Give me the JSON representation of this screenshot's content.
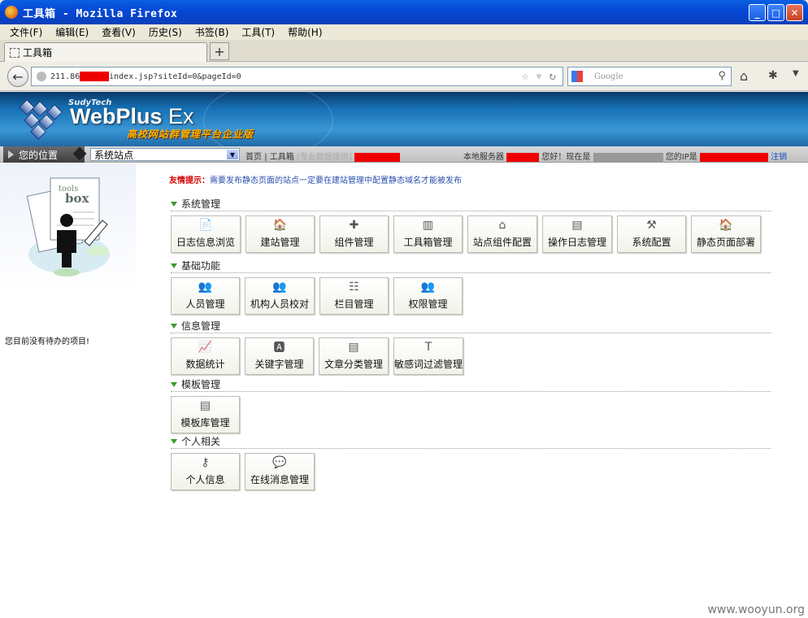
{
  "window": {
    "title": "工具箱 - Mozilla Firefox"
  },
  "menu": [
    "文件(F)",
    "编辑(E)",
    "查看(V)",
    "历史(S)",
    "书签(B)",
    "工具(T)",
    "帮助(H)"
  ],
  "tab": {
    "title": "工具箱",
    "new_tab": "+"
  },
  "address": {
    "prefix": "211.86",
    "suffix": "index.jsp?siteId=0&pageId=0"
  },
  "search": {
    "placeholder": "Google"
  },
  "banner": {
    "sub": "SudyTech",
    "brand": "WebPlus",
    "brand_ex": " Ex",
    "cn": "高校网站群管理平台企业版"
  },
  "location": {
    "label": "您的位置",
    "select_value": "系统站点",
    "home": "首页",
    "sep": "|",
    "toolbox": "工具箱",
    "provider": "[专业数据提供]",
    "server": "本地服务器",
    "greeting": "您好！现在是",
    "ip_label": "您的IP是",
    "logout": "注销"
  },
  "sidebar": {
    "art_top": "tools",
    "art_mid": "box",
    "note": "您目前没有待办的项目!"
  },
  "tip": {
    "label": "友情提示：",
    "text": "需要发布静态页面的站点一定要在建站管理中配置静态域名才能被发布"
  },
  "sections": [
    {
      "title": "系统管理",
      "items": [
        {
          "label": "日志信息浏览",
          "icon": "log-icon"
        },
        {
          "label": "建站管理",
          "icon": "site-build-icon"
        },
        {
          "label": "组件管理",
          "icon": "component-icon"
        },
        {
          "label": "工具箱管理",
          "icon": "toolbox-icon"
        },
        {
          "label": "站点组件配置",
          "icon": "site-component-icon"
        },
        {
          "label": "操作日志管理",
          "icon": "operation-log-icon"
        },
        {
          "label": "系统配置",
          "icon": "system-config-icon"
        },
        {
          "label": "静态页面部署",
          "icon": "static-deploy-icon"
        }
      ]
    },
    {
      "title": "基础功能",
      "items": [
        {
          "label": "人员管理",
          "icon": "users-icon"
        },
        {
          "label": "机构人员校对",
          "icon": "org-check-icon"
        },
        {
          "label": "栏目管理",
          "icon": "column-tree-icon"
        },
        {
          "label": "权限管理",
          "icon": "permission-icon"
        }
      ]
    },
    {
      "title": "信息管理",
      "items": [
        {
          "label": "数据统计",
          "icon": "chart-icon"
        },
        {
          "label": "关键字管理",
          "icon": "keyword-icon"
        },
        {
          "label": "文章分类管理",
          "icon": "article-category-icon"
        },
        {
          "label": "敏感词过滤管理",
          "icon": "sensitive-word-icon"
        }
      ]
    },
    {
      "title": "模板管理",
      "items": [
        {
          "label": "模板库管理",
          "icon": "template-icon"
        }
      ]
    },
    {
      "title": "个人相关",
      "items": [
        {
          "label": "个人信息",
          "icon": "key-icon"
        },
        {
          "label": "在线消息管理",
          "icon": "message-icon"
        }
      ]
    }
  ],
  "watermark": "www.wooyun.org"
}
